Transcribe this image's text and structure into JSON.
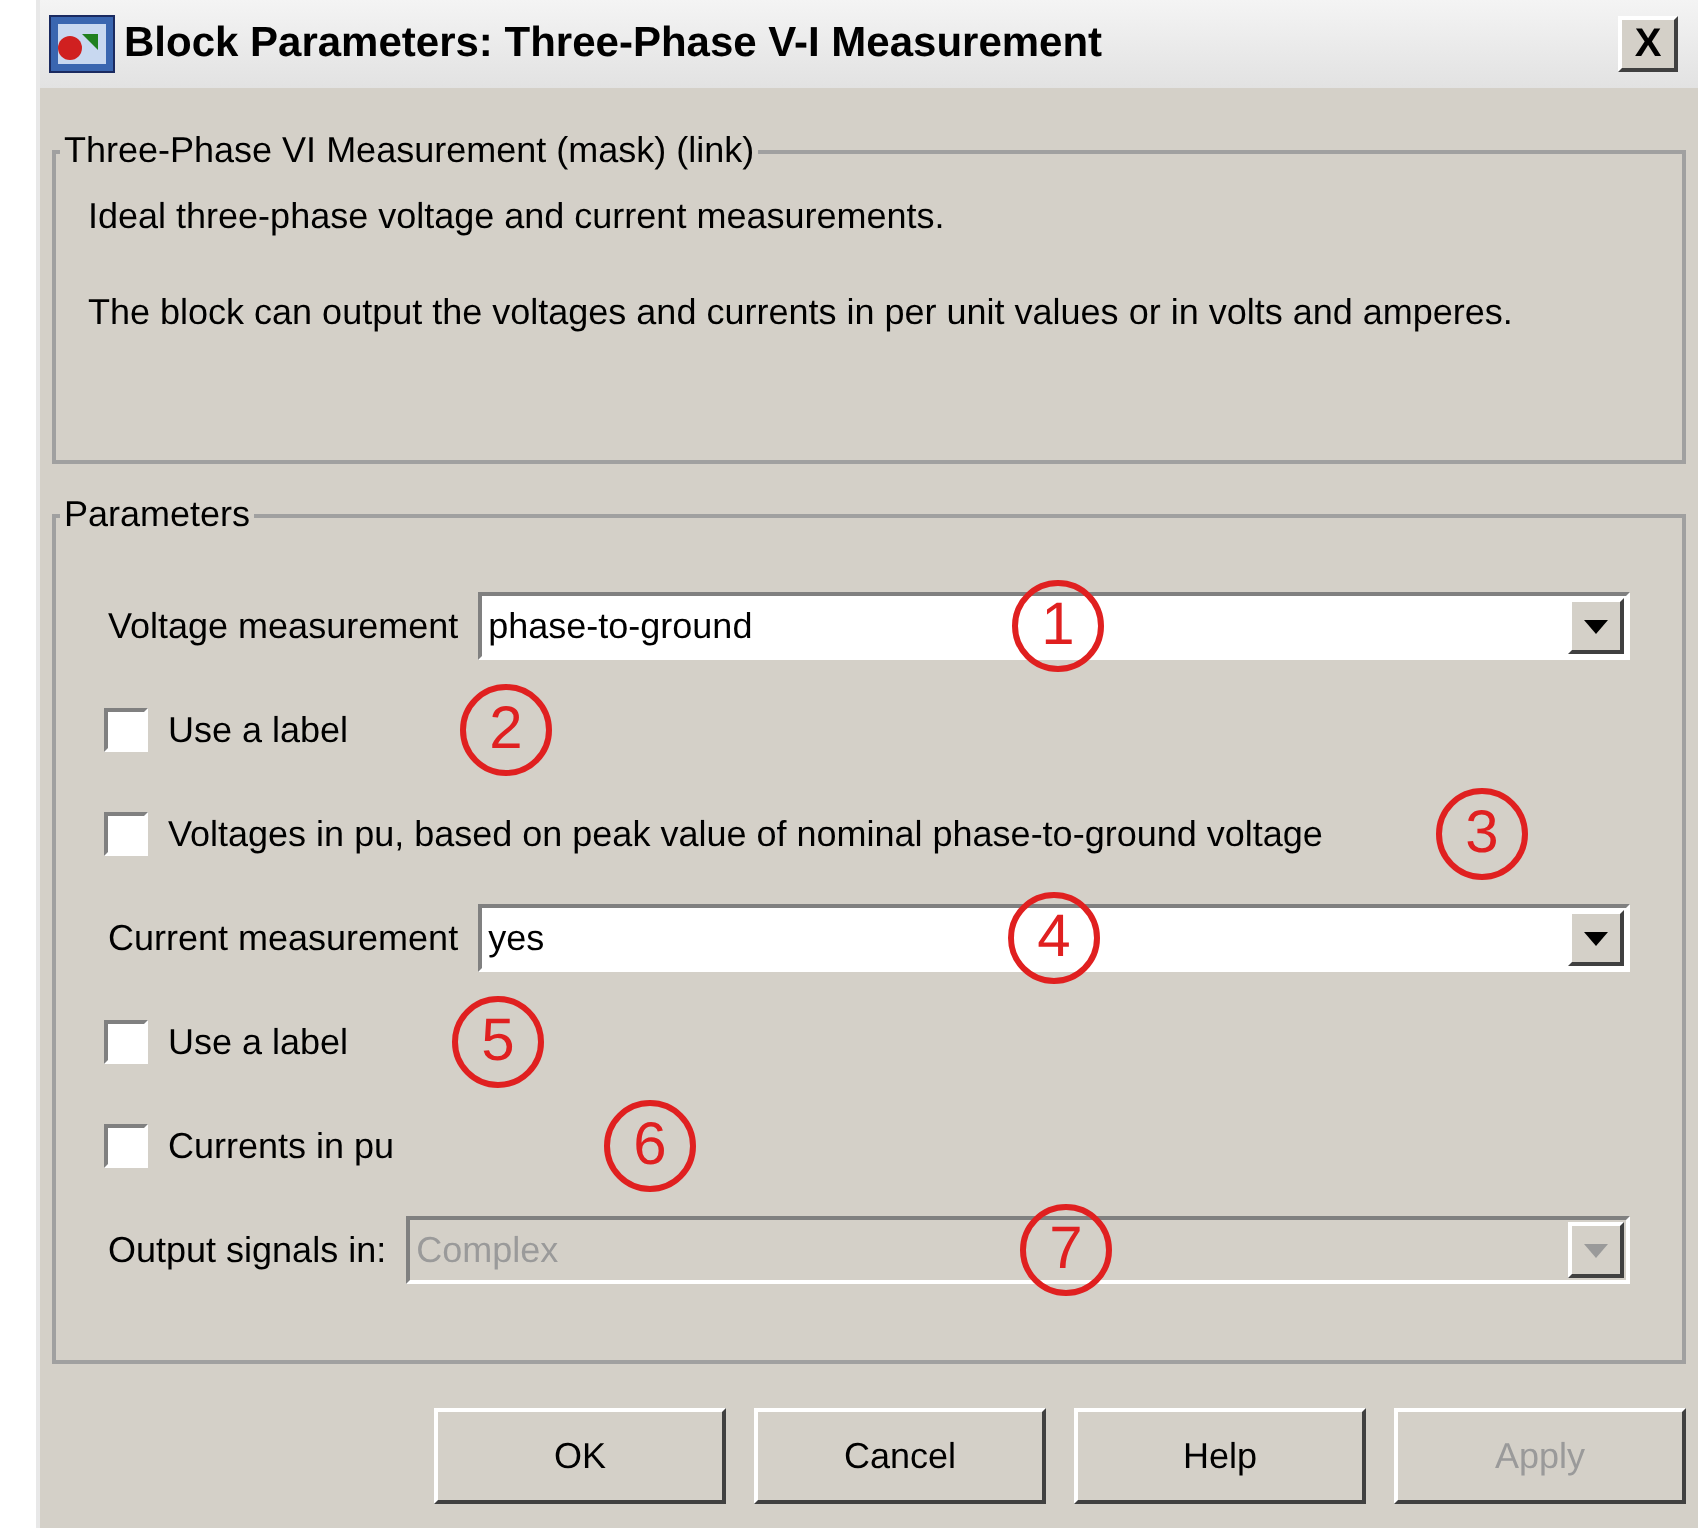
{
  "window": {
    "title": "Block Parameters: Three-Phase V-I Measurement",
    "close": "X"
  },
  "description_group": {
    "title": "Three-Phase VI Measurement (mask) (link)",
    "paragraphs": [
      "Ideal three-phase voltage and current measurements.",
      "The block can output the voltages and currents in per unit values or in volts and amperes."
    ]
  },
  "parameters_group": {
    "title": "Parameters",
    "items": [
      {
        "kind": "dropdown",
        "label": "Voltage measurement",
        "value": "phase-to-ground",
        "disabled": false,
        "marker": "1"
      },
      {
        "kind": "checkbox",
        "label": "Use a label",
        "checked": false,
        "marker": "2"
      },
      {
        "kind": "checkbox",
        "label": "Voltages in pu,  based on peak value of nominal phase-to-ground voltage",
        "checked": false,
        "marker": "3"
      },
      {
        "kind": "dropdown",
        "label": "Current measurement",
        "value": "yes",
        "disabled": false,
        "marker": "4"
      },
      {
        "kind": "checkbox",
        "label": "Use a label",
        "checked": false,
        "marker": "5"
      },
      {
        "kind": "checkbox",
        "label": "Currents in pu",
        "checked": false,
        "marker": "6"
      },
      {
        "kind": "dropdown",
        "label": "Output signals in:",
        "value": "Complex",
        "disabled": true,
        "marker": "7"
      }
    ]
  },
  "buttons": [
    {
      "label": "OK",
      "disabled": false
    },
    {
      "label": "Cancel",
      "disabled": false
    },
    {
      "label": "Help",
      "disabled": false
    },
    {
      "label": "Apply",
      "disabled": true
    }
  ]
}
